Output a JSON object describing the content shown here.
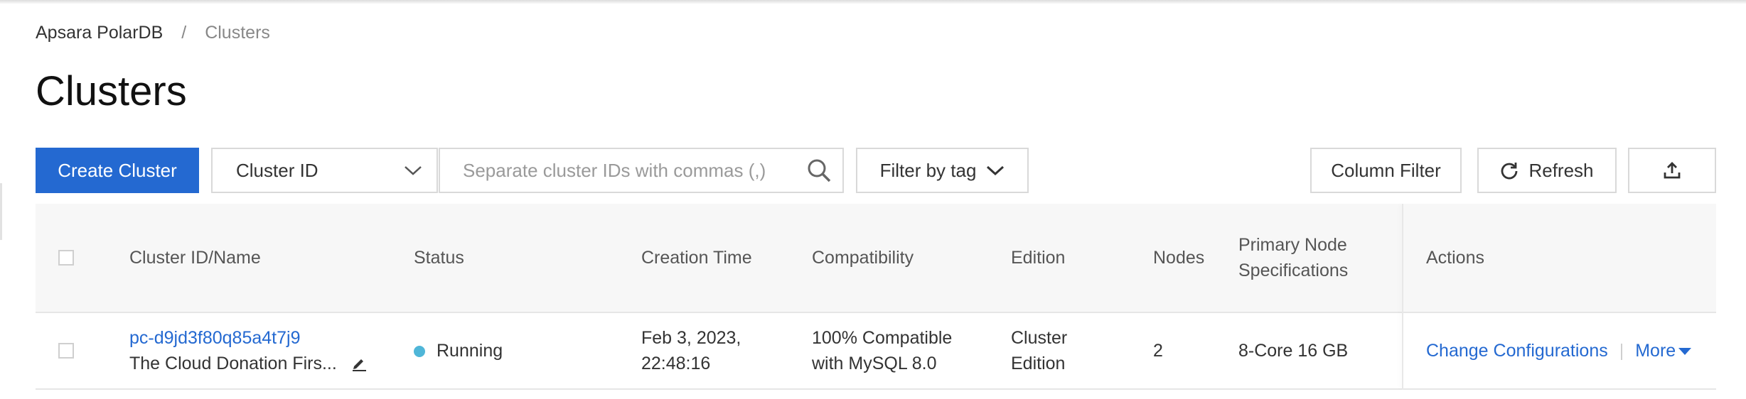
{
  "breadcrumb": {
    "root": "Apsara PolarDB",
    "separator": "/",
    "current": "Clusters"
  },
  "page": {
    "title": "Clusters"
  },
  "toolbar": {
    "create_label": "Create Cluster",
    "select_value": "Cluster ID",
    "search_placeholder": "Separate cluster IDs with commas (,)",
    "tag_filter_label": "Filter by tag",
    "column_filter_label": "Column Filter",
    "refresh_label": "Refresh"
  },
  "table": {
    "headers": {
      "id_name": "Cluster ID/Name",
      "status": "Status",
      "creation_time": "Creation Time",
      "compatibility": "Compatibility",
      "edition": "Edition",
      "nodes": "Nodes",
      "primary_spec_line1": "Primary Node",
      "primary_spec_line2": "Specifications",
      "actions": "Actions"
    },
    "rows": [
      {
        "id": "pc-d9jd3f80q85a4t7j9",
        "name": "The Cloud Donation Firs...",
        "status": "Running",
        "creation_date": "Feb 3, 2023,",
        "creation_clock": "22:48:16",
        "compat_line1": "100% Compatible",
        "compat_line2": "with MySQL 8.0",
        "edition_line1": "Cluster",
        "edition_line2": "Edition",
        "nodes": "2",
        "spec": "8-Core 16 GB",
        "action_change": "Change Configurations",
        "action_more": "More"
      }
    ]
  },
  "colors": {
    "accent": "#2469d1",
    "running": "#4fb6d8"
  },
  "icons": [
    "chevron-down-icon",
    "search-icon",
    "refresh-icon",
    "export-icon",
    "edit-icon",
    "caret-down-icon"
  ]
}
